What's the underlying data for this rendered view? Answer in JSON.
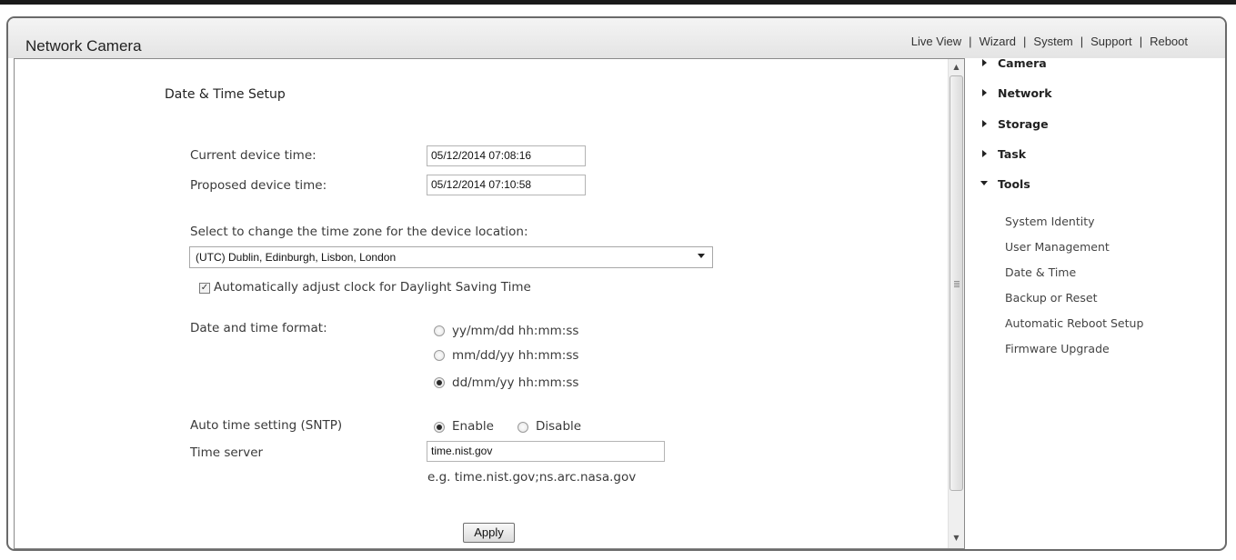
{
  "app": {
    "title": "Network Camera"
  },
  "topnav": [
    {
      "label": "Live View"
    },
    {
      "label": "Wizard"
    },
    {
      "label": "System"
    },
    {
      "label": "Support"
    },
    {
      "label": "Reboot"
    }
  ],
  "page": {
    "title": "Date & Time Setup",
    "current_time_label": "Current device time:",
    "current_time_value": "05/12/2014 07:08:16",
    "proposed_time_label": "Proposed device time:",
    "proposed_time_value": "05/12/2014 07:10:58",
    "timezone_label": "Select to change the time zone for the device location:",
    "timezone_value": "(UTC) Dublin, Edinburgh, Lisbon, London",
    "dst_label": "Automatically adjust clock for Daylight Saving Time",
    "dst_checked": true,
    "format_label": "Date and time format:",
    "format_options": [
      {
        "label": "yy/mm/dd hh:mm:ss",
        "selected": false
      },
      {
        "label": "mm/dd/yy hh:mm:ss",
        "selected": false
      },
      {
        "label": "dd/mm/yy hh:mm:ss",
        "selected": true
      }
    ],
    "sntp_label": "Auto time setting (SNTP)",
    "sntp_enable_label": "Enable",
    "sntp_disable_label": "Disable",
    "sntp_value": "Enable",
    "time_server_label": "Time server",
    "time_server_value": "time.nist.gov",
    "time_server_hint": "e.g. time.nist.gov;ns.arc.nasa.gov",
    "apply_label": "Apply"
  },
  "sidebar": {
    "sections": [
      {
        "label": "Camera",
        "expanded": false
      },
      {
        "label": "Network",
        "expanded": false
      },
      {
        "label": "Storage",
        "expanded": false
      },
      {
        "label": "Task",
        "expanded": false
      },
      {
        "label": "Tools",
        "expanded": true
      }
    ],
    "tools_items": [
      {
        "label": "System Identity"
      },
      {
        "label": "User Management"
      },
      {
        "label": "Date & Time"
      },
      {
        "label": "Backup or Reset"
      },
      {
        "label": "Automatic Reboot Setup"
      },
      {
        "label": "Firmware Upgrade"
      }
    ]
  },
  "colors": {
    "frame_border": "#6a6a6a",
    "header_bg": "#e8e8e8",
    "text": "#333333"
  },
  "icons": [
    "scroll-up-arrow-icon",
    "scroll-down-arrow-icon",
    "expand-arrow-icon",
    "collapse-arrow-icon",
    "checkmark-icon"
  ]
}
